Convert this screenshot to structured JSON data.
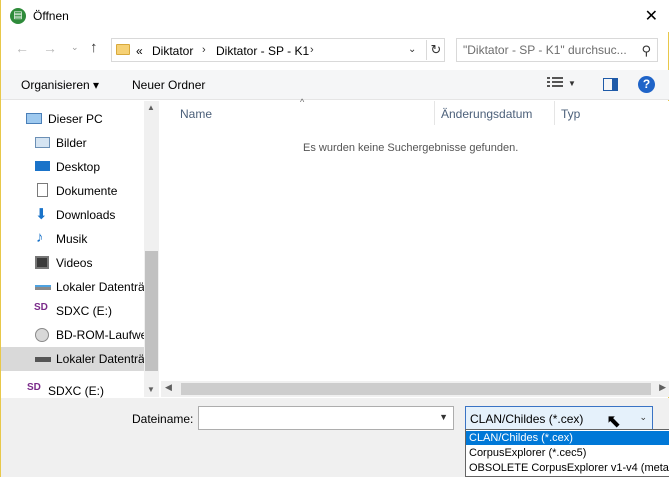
{
  "window": {
    "title": "Öffnen",
    "close_glyph": "✕"
  },
  "address": {
    "crumbs": [
      "Diktator",
      "Diktator - SP - K1"
    ],
    "prefix": "«",
    "search_placeholder": "\"Diktator - SP - K1\" durchsuc..."
  },
  "toolbar": {
    "organize_label": "Organisieren ▾",
    "new_folder_label": "Neuer Ordner",
    "help_label": "?"
  },
  "nav": {
    "items": [
      {
        "label": "Dieser PC",
        "icon": "computer-icon"
      },
      {
        "label": "Bilder",
        "icon": "pictures-icon"
      },
      {
        "label": "Desktop",
        "icon": "desktop-icon"
      },
      {
        "label": "Dokumente",
        "icon": "documents-icon"
      },
      {
        "label": "Downloads",
        "icon": "downloads-icon"
      },
      {
        "label": "Musik",
        "icon": "music-icon"
      },
      {
        "label": "Videos",
        "icon": "videos-icon"
      },
      {
        "label": "Lokaler Datenträ",
        "icon": "drive-icon"
      },
      {
        "label": "SDXC (E:)",
        "icon": "sd-card-icon"
      },
      {
        "label": "BD-ROM-Laufwe",
        "icon": "disc-icon"
      },
      {
        "label": "Lokaler Datenträ",
        "icon": "drive-icon",
        "selected": true
      },
      {
        "label": "SDXC (E:)",
        "icon": "sd-card-icon"
      }
    ]
  },
  "list": {
    "columns": [
      "Name",
      "Änderungsdatum",
      "Typ"
    ],
    "empty_message": "Es wurden keine Suchergebnisse gefunden."
  },
  "footer": {
    "filename_label": "Dateiname:",
    "filename_value": "",
    "filetype_selected": "CLAN/Childes (*.cex)",
    "filetype_options": [
      "CLAN/Childes (*.cex)",
      "CorpusExplorer (*.cec5)",
      "OBSOLETE CorpusExplorer v1-v4 (meta)"
    ]
  }
}
